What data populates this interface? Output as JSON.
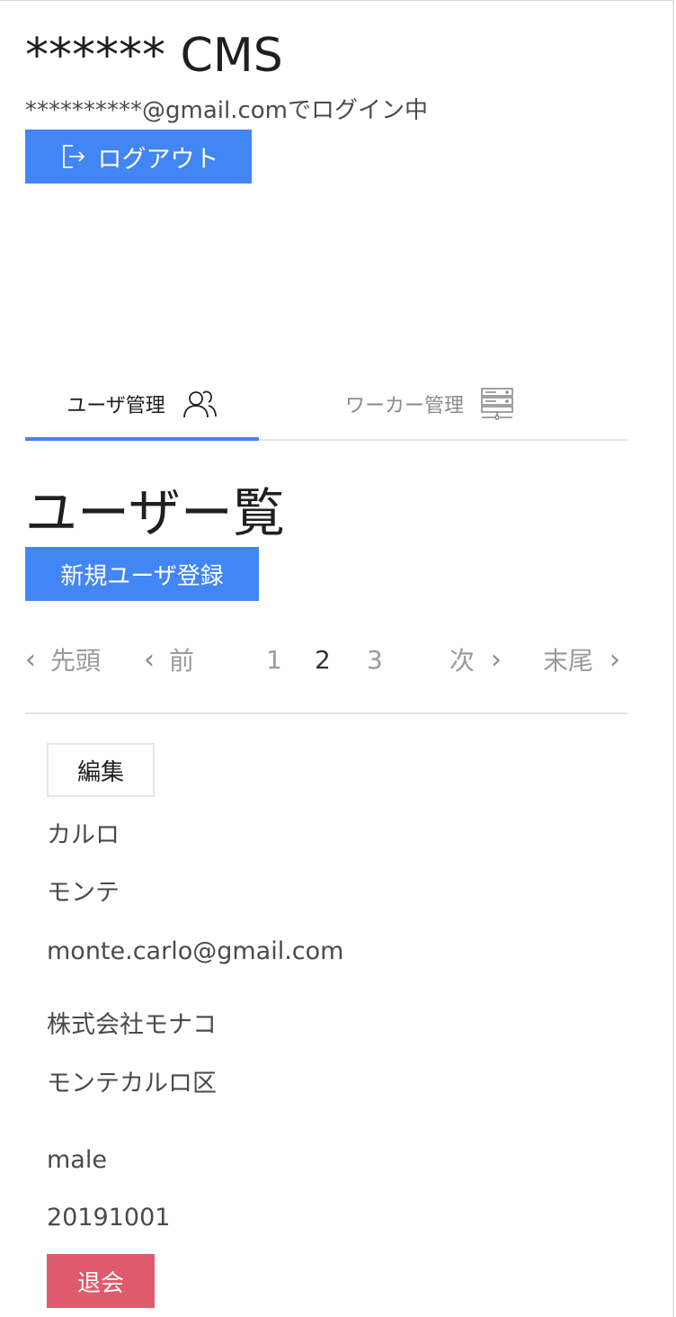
{
  "header": {
    "app_title": "****** CMS",
    "login_status": "**********@gmail.comでログイン中",
    "logout_label": "ログアウト"
  },
  "tabs": [
    {
      "label": "ユーザ管理",
      "icon": "users-icon",
      "active": true
    },
    {
      "label": "ワーカー管理",
      "icon": "server-icon",
      "active": false
    }
  ],
  "main": {
    "title": "ユーザー覧",
    "register_label": "新規ユーザ登録"
  },
  "pagination": {
    "first_label": "先頭",
    "prev_label": "前",
    "pages": [
      "1",
      "2",
      "3"
    ],
    "current_page": "2",
    "next_label": "次",
    "last_label": "末尾",
    "chevron_left": "‹",
    "chevron_right": "›"
  },
  "user": {
    "edit_label": "編集",
    "first_name": "カルロ",
    "last_name": "モンテ",
    "email": "monte.carlo@gmail.com",
    "company": "株式会社モナコ",
    "address": "モンテカルロ区",
    "gender": "male",
    "date": "20191001",
    "withdraw_label": "退会"
  },
  "colors": {
    "primary": "#4285f4",
    "danger": "#e05a6d",
    "divider": "#e3e3e3"
  }
}
